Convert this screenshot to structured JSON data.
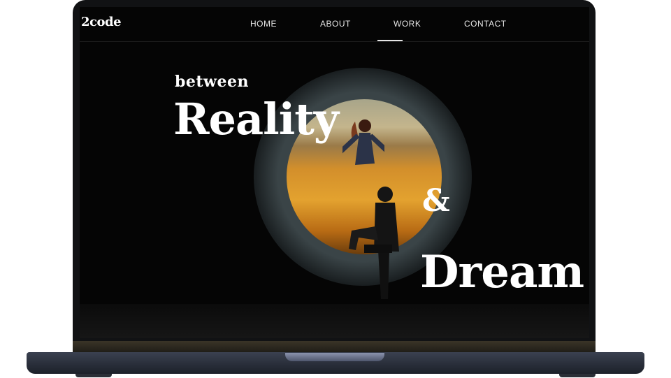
{
  "brand": {
    "logo": "2code"
  },
  "nav": {
    "items": [
      {
        "label": "HOME"
      },
      {
        "label": "ABOUT"
      },
      {
        "label": "WORK"
      },
      {
        "label": "CONTACT"
      }
    ],
    "active": "WORK"
  },
  "hero": {
    "line1": "between",
    "line2": "Reality",
    "amp": "&",
    "line3": "Dream"
  },
  "colors": {
    "text": "#ffffff",
    "background": "#050505",
    "laptop_frame": "#111214",
    "accent_flowers": "#e3a22f"
  }
}
